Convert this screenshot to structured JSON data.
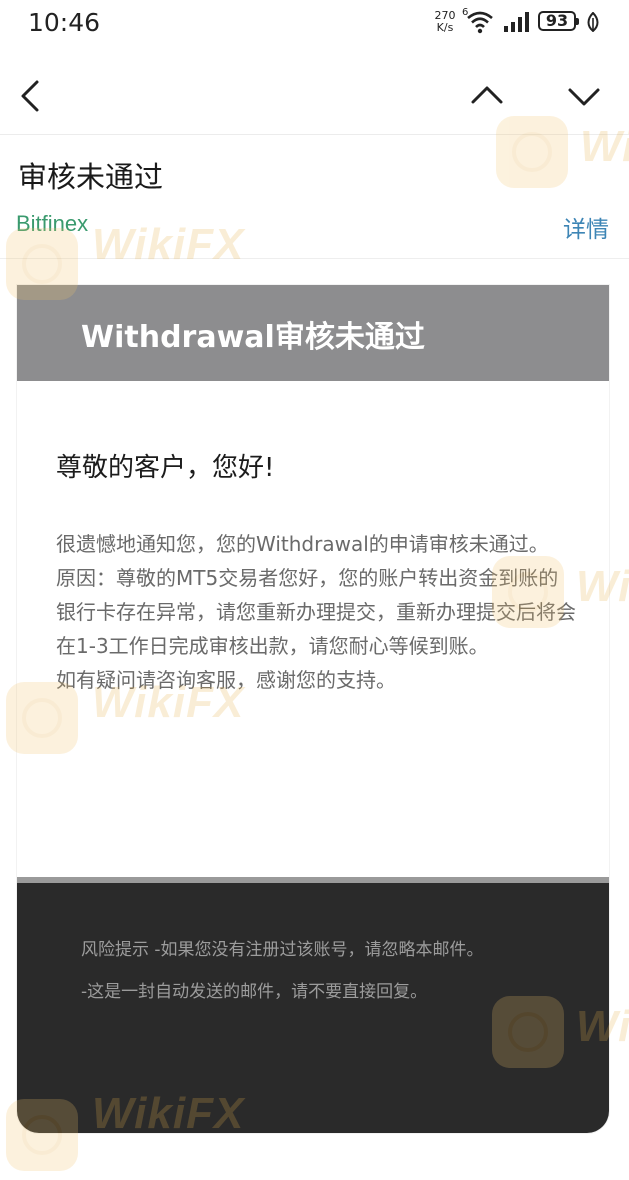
{
  "status_bar": {
    "time": "10:46",
    "net_speed_value": "270",
    "net_speed_unit": "K/s",
    "wifi_label": "6",
    "battery": "93",
    "icons": [
      "wifi-icon",
      "signal-icon",
      "battery-icon",
      "leaf-icon"
    ]
  },
  "nav": {
    "icons": [
      "back-icon",
      "chevron-up-icon",
      "chevron-down-icon"
    ]
  },
  "mail": {
    "subject": "审核未通过",
    "sender": "Bitfinex",
    "details_link": "详情"
  },
  "email": {
    "header_title": "Withdrawal审核未通过",
    "greeting": "尊敬的客户，您好!",
    "paragraphs": [
      "很遗憾地通知您，您的Withdrawal的申请审核未通过。",
      "原因：尊敬的MT5交易者您好，您的账户转出资金到账的银行卡存在异常，请您重新办理提交，重新办理提交后将会在1-3工作日完成审核出款，请您耐心等候到账。",
      "如有疑问请咨询客服，感谢您的支持。"
    ],
    "footer_lines": [
      "风险提示 -如果您没有注册过该账号，请忽略本邮件。",
      "-这是一封自动发送的邮件，请不要直接回复。"
    ]
  },
  "watermark": {
    "text": "WikiFX",
    "color": "#e7b14a"
  },
  "colors": {
    "sender": "#3a9a6e",
    "link": "#3d85b5",
    "header_band": "#8d8d8f",
    "footer_band": "#2a2a2a"
  }
}
